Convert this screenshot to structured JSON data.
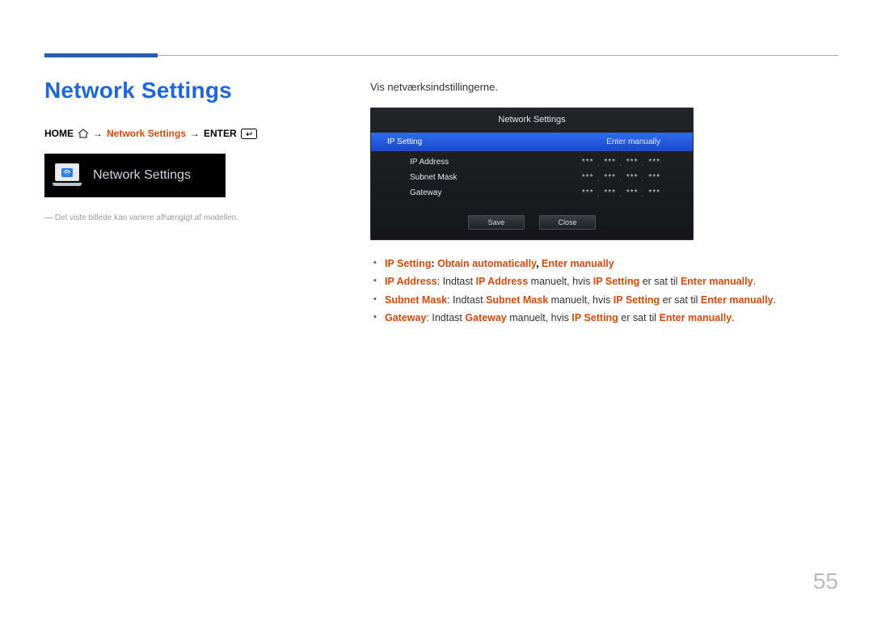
{
  "page": {
    "title": "Network Settings",
    "number": "55",
    "disclaimer": "Det viste billede kan variere afhængigt af modellen."
  },
  "breadcrumb": {
    "home": "HOME",
    "step": "Network Settings",
    "enter": "ENTER"
  },
  "thumbnail": {
    "title": "Network Settings"
  },
  "intro": "Vis netværksindstillingerne.",
  "panel": {
    "title": "Network Settings",
    "selected": {
      "label": "IP Setting",
      "value": "Enter manually"
    },
    "rows": [
      {
        "label": "IP Address"
      },
      {
        "label": "Subnet Mask"
      },
      {
        "label": "Gateway"
      }
    ],
    "mask_group": "***",
    "buttons": {
      "save": "Save",
      "close": "Close"
    }
  },
  "bullets": {
    "b1": {
      "t1": "IP Setting",
      "sep": ": ",
      "t2": "Obtain automatically",
      "comma": ", ",
      "t3": "Enter manually"
    },
    "b2": {
      "t1": "IP Address",
      "sep": ": Indtast ",
      "t2": "IP Address",
      "mid": " manuelt, hvis ",
      "t3": "IP Setting",
      "mid2": " er sat til ",
      "t4": "Enter manually",
      "dot": "."
    },
    "b3": {
      "t1": "Subnet Mask",
      "sep": ": Indtast ",
      "t2": "Subnet Mask",
      "mid": " manuelt, hvis ",
      "t3": "IP Setting",
      "mid2": " er sat til ",
      "t4": "Enter manually",
      "dot": "."
    },
    "b4": {
      "t1": "Gateway",
      "sep": ": Indtast ",
      "t2": "Gateway",
      "mid": " manuelt, hvis ",
      "t3": "IP Setting",
      "mid2": " er sat til ",
      "t4": "Enter manually",
      "dot": "."
    }
  }
}
